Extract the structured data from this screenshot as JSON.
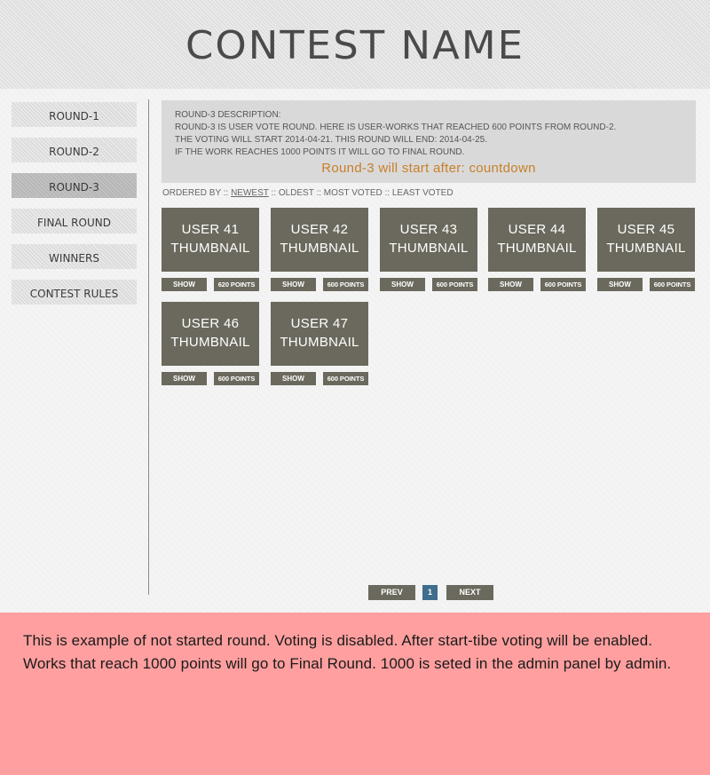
{
  "header": {
    "title": "CONTEST NAME"
  },
  "sidebar": {
    "items": [
      {
        "label": "ROUND-1",
        "active": false
      },
      {
        "label": "ROUND-2",
        "active": false
      },
      {
        "label": "ROUND-3",
        "active": true
      },
      {
        "label": "FINAL ROUND",
        "active": false
      },
      {
        "label": "WINNERS",
        "active": false
      },
      {
        "label": "CONTEST RULES",
        "active": false
      }
    ]
  },
  "description": {
    "lines": [
      "ROUND-3 DESCRIPTION:",
      "ROUND-3 IS USER VOTE ROUND. HERE IS USER-WORKS THAT REACHED 600 POINTS FROM ROUND-2.",
      "THE VOTING WILL START 2014-04-21.  THIS ROUND WILL END: 2014-04-25.",
      "IF THE WORK REACHES 1000 POINTS IT WILL GO TO FINAL ROUND."
    ],
    "countdown": "Round-3 will start after:  countdown"
  },
  "ordering": {
    "prefix": "ORDERED BY",
    "separator": "::",
    "options": [
      "NEWEST",
      "OLDEST",
      "MOST VOTED",
      "LEAST VOTED"
    ],
    "selected": "NEWEST"
  },
  "works": [
    {
      "user": "USER 41",
      "thumb": "THUMBNAIL",
      "show": "SHOW",
      "points": "620 POINTS"
    },
    {
      "user": "USER 42",
      "thumb": "THUMBNAIL",
      "show": "SHOW",
      "points": "600 POINTS"
    },
    {
      "user": "USER 43",
      "thumb": "THUMBNAIL",
      "show": "SHOW",
      "points": "600 POINTS"
    },
    {
      "user": "USER 44",
      "thumb": "THUMBNAIL",
      "show": "SHOW",
      "points": "600 POINTS"
    },
    {
      "user": "USER 45",
      "thumb": "THUMBNAIL",
      "show": "SHOW",
      "points": "600 POINTS"
    },
    {
      "user": "USER 46",
      "thumb": "THUMBNAIL",
      "show": "SHOW",
      "points": "600 POINTS"
    },
    {
      "user": "USER 47",
      "thumb": "THUMBNAIL",
      "show": "SHOW",
      "points": "600 POINTS"
    }
  ],
  "pagination": {
    "prev": "PREV",
    "current": "1",
    "next": "NEXT"
  },
  "note": {
    "text": "This is example of not started round. Voting is disabled. After start-tibe voting will be enabled. Works that reach 1000 points will go to Final Round. 1000 is seted in the admin panel by admin."
  },
  "colors": {
    "tile": "#6b695d",
    "countdown": "#c8802a",
    "page_active": "#3f6d8e",
    "note_bg": "#ff9f9f"
  }
}
